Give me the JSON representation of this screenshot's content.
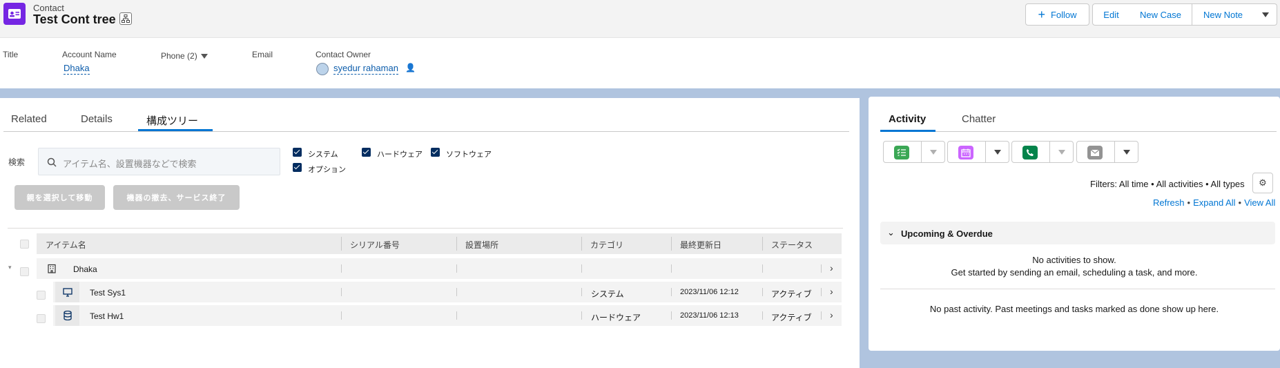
{
  "header": {
    "object_type": "Contact",
    "record_name": "Test Cont tree",
    "buttons": {
      "follow": "Follow",
      "edit": "Edit",
      "new_case": "New Case",
      "new_note": "New Note"
    }
  },
  "highlights": {
    "title_label": "Title",
    "account_label": "Account Name",
    "account_value": "Dhaka",
    "phone_label": "Phone (2)",
    "email_label": "Email",
    "owner_label": "Contact Owner",
    "owner_value": "syedur rahaman"
  },
  "left": {
    "tabs": [
      "Related",
      "Details",
      "構成ツリー"
    ],
    "search_label": "検索",
    "search_placeholder": "アイテム名、設置機器などで検索",
    "filters": [
      "システム",
      "ハードウェア",
      "ソフトウェア",
      "オプション"
    ],
    "buttons": {
      "move": "親を選択して移動",
      "remove": "機器の撤去、サービス終了"
    },
    "columns": [
      "アイテム名",
      "シリアル番号",
      "設置場所",
      "カテゴリ",
      "最終更新日",
      "ステータス"
    ],
    "rows": [
      {
        "name": "Dhaka",
        "serial": "",
        "location": "",
        "category": "",
        "updated": "",
        "status": ""
      },
      {
        "name": "Test Sys1",
        "serial": "",
        "location": "",
        "category": "システム",
        "updated": "2023/11/06 12:12",
        "status": "アクティブ"
      },
      {
        "name": "Test Hw1",
        "serial": "",
        "location": "",
        "category": "ハードウェア",
        "updated": "2023/11/06 12:13",
        "status": "アクティブ"
      }
    ]
  },
  "right": {
    "tabs": [
      "Activity",
      "Chatter"
    ],
    "filters_text": "Filters: All time • All activities • All types",
    "links": {
      "refresh": "Refresh",
      "expand": "Expand All",
      "view": "View All"
    },
    "upcoming_title": "Upcoming & Overdue",
    "empty_line1": "No activities to show.",
    "empty_line2": "Get started by sending an email, scheduling a task, and more.",
    "past_text": "No past activity. Past meetings and tasks marked as done show up here."
  },
  "colors": {
    "brand": "#0176d3",
    "object_icon": "#7526e3",
    "task": "#3ba755",
    "event": "#cb65ff",
    "call": "#04844b",
    "email": "#939393"
  }
}
